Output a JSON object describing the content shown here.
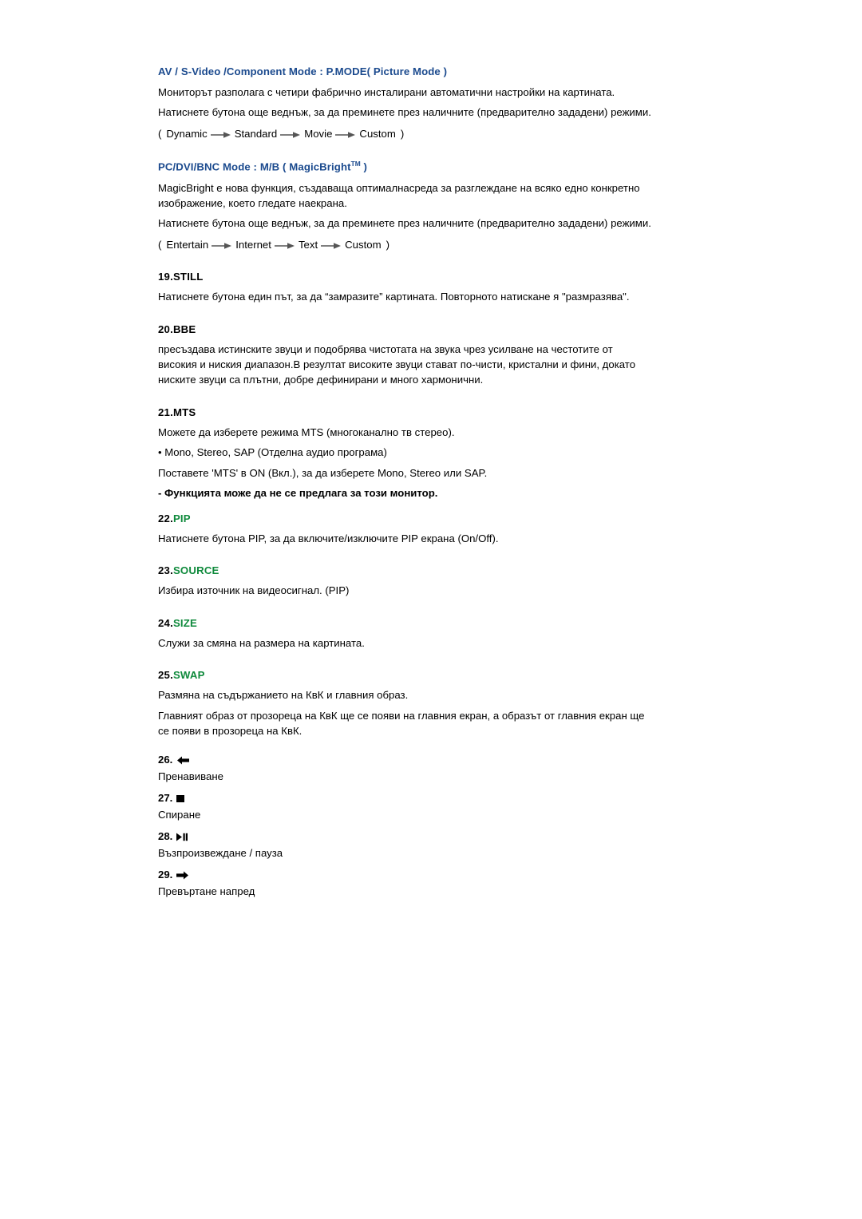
{
  "document": {
    "sections": [
      {
        "id": "av-picture-mode",
        "heading": "AV / S-Video /Component Mode : P.MODE( Picture Mode )",
        "paragraphs": [
          "Мониторът разполага с четири фабрично инсталирани автоматични настройки на картината.",
          "Натиснете бутона още веднъж, за да преминете през наличните (предварително зададени) режими."
        ],
        "flow": {
          "open": "(",
          "items": [
            "Dynamic",
            "Standard",
            "Movie",
            "Custom"
          ],
          "close": ")"
        }
      },
      {
        "id": "pc-dvi-bnc-magicbright",
        "heading_pre": "PC/DVI/BNC Mode : M/B ( MagicBright",
        "heading_sup": "TM",
        "heading_post": " )",
        "paragraphs": [
          "MagicBright е нова функция, създаваща оптималнасреда за разглеждане на всяко едно конкретно изображение, което гледате наекрана.",
          "Натиснете бутона още веднъж, за да преминете през наличните (предварително зададени) режими."
        ],
        "flow": {
          "open": "(",
          "items": [
            "Entertain",
            "Internet",
            "Text",
            "Custom"
          ],
          "close": ")"
        }
      }
    ],
    "items": [
      {
        "number": "19.",
        "label": "STILL",
        "label_color": "dark",
        "body": "Натиснете бутона един път, за да “замразите” картината. Повторното натискане я \"размразява\"."
      },
      {
        "number": "20.",
        "label": "BBE",
        "label_color": "dark",
        "body": "пресъздава истинските звуци и подобрява чистотата на звука чрез усилване на честотите от високия и ниския диапазон.В резултат високите звуци стават по-чисти, кристални и фини, докато ниските звуци са плътни, добре дефинирани и много хармонични."
      },
      {
        "number": "21.",
        "label": "MTS",
        "label_color": "dark",
        "body_lines": [
          "Можете да изберете режима MTS (многоканално тв стерео).",
          "• Mono, Stereo, SAP (Отделна аудио програма)",
          "Поставете 'MTS' в ON (Вкл.), за да изберете Mono, Stereo или SAP."
        ],
        "note": "- Функцията може да не се предлага за този монитор."
      },
      {
        "number": "22.",
        "label": "PIP",
        "label_color": "green",
        "body": "Натиснете бутона PIP, за да включите/изключите PIP екрана (On/Off)."
      },
      {
        "number": "23.",
        "label": "SOURCE",
        "label_color": "green",
        "body": "Избира източник на видеосигнал. (PIP)"
      },
      {
        "number": "24.",
        "label": "SIZE",
        "label_color": "green",
        "body": "Служи за смяна на размера на картината."
      },
      {
        "number": "25.",
        "label": "SWAP",
        "label_color": "green",
        "body_lines": [
          "Размяна на съдържанието на КвК и главния образ.",
          "Главният образ от прозореца на КвК ще се появи на главния екран, а образът от главния екран ще се появи в прозореца на КвК."
        ]
      }
    ],
    "transport": [
      {
        "number": "26.",
        "icon": "rewind-icon",
        "caption": "Пренавиване"
      },
      {
        "number": "27.",
        "icon": "stop-icon",
        "caption": "Спиране"
      },
      {
        "number": "28.",
        "icon": "play-pause-icon",
        "caption": "Възпроизвеждане / пауза"
      },
      {
        "number": "29.",
        "icon": "fast-forward-icon",
        "caption": "Превъртане напред"
      }
    ]
  },
  "colors": {
    "heading_blue": "#1b4a8e",
    "label_green": "#0f8a3c",
    "text": "#000000",
    "background": "#ffffff"
  }
}
